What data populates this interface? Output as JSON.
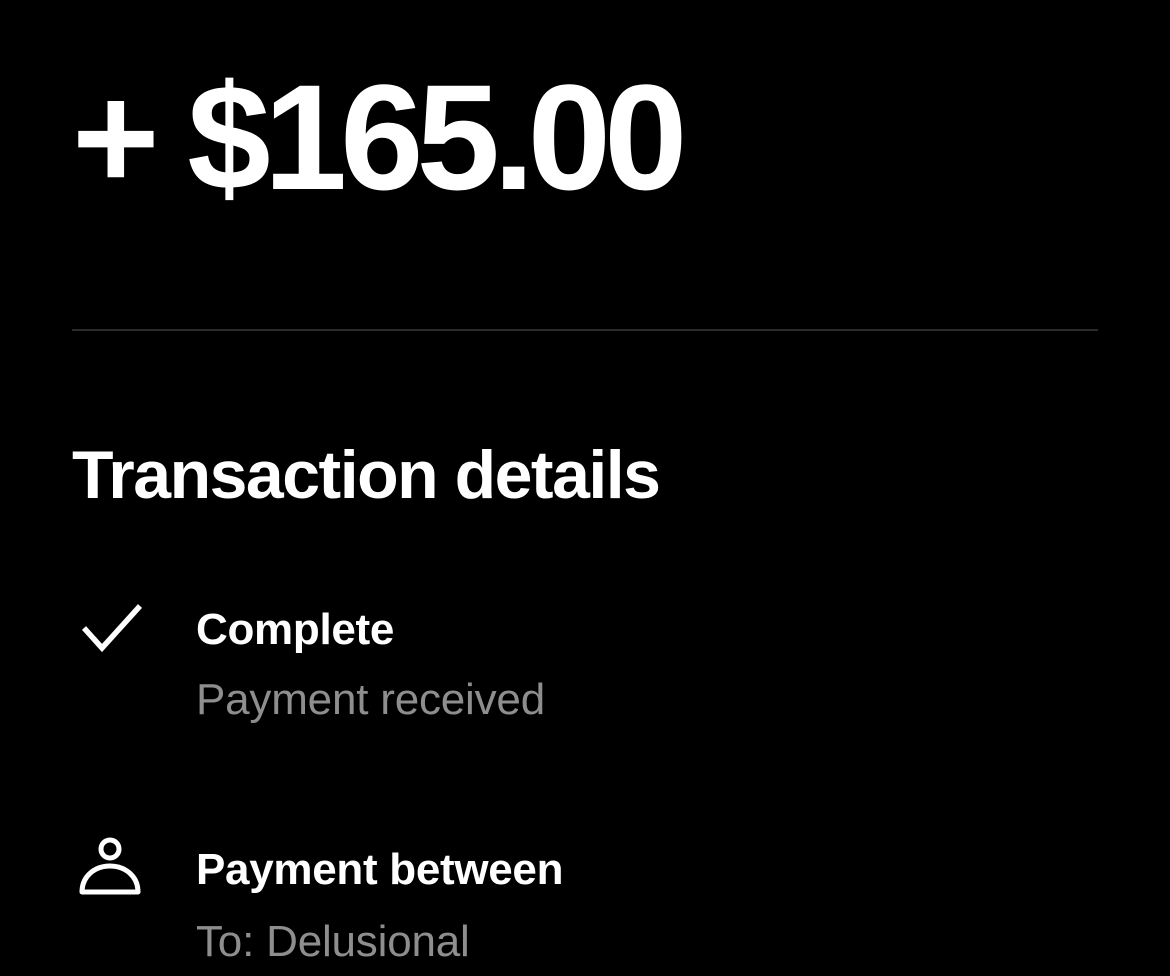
{
  "transaction": {
    "amount": "+ $165.00"
  },
  "details": {
    "title": "Transaction details",
    "status": {
      "icon": "checkmark-icon",
      "title": "Complete",
      "subtitle": "Payment received"
    },
    "payment_between": {
      "icon": "person-icon",
      "title": "Payment between",
      "subtitle": "To: Delusional"
    }
  },
  "colors": {
    "background": "#000000",
    "primary_text": "#ffffff",
    "secondary_text": "#8e8e8e",
    "divider": "#2b2b2b"
  }
}
